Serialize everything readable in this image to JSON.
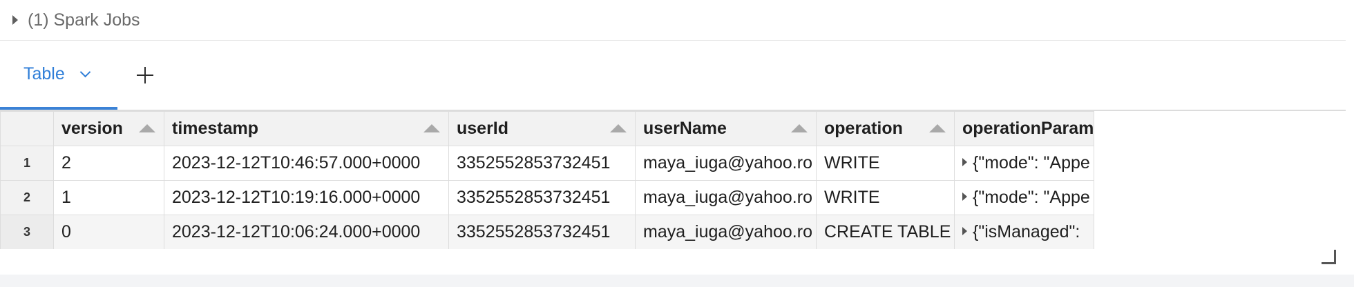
{
  "jobs": {
    "label": "(1) Spark Jobs"
  },
  "tabs": {
    "active_label": "Table"
  },
  "grid": {
    "columns": [
      "version",
      "timestamp",
      "userId",
      "userName",
      "operation",
      "operationParam"
    ],
    "rows": [
      {
        "num": "1",
        "version": "2",
        "timestamp": "2023-12-12T10:46:57.000+0000",
        "userId": "3352552853732451",
        "userName": "maya_iuga@yahoo.ro",
        "operation": "WRITE",
        "operationParameters": "{\"mode\": \"Appe"
      },
      {
        "num": "2",
        "version": "1",
        "timestamp": "2023-12-12T10:19:16.000+0000",
        "userId": "3352552853732451",
        "userName": "maya_iuga@yahoo.ro",
        "operation": "WRITE",
        "operationParameters": "{\"mode\": \"Appe"
      },
      {
        "num": "3",
        "version": "0",
        "timestamp": "2023-12-12T10:06:24.000+0000",
        "userId": "3352552853732451",
        "userName": "maya_iuga@yahoo.ro",
        "operation": "CREATE TABLE",
        "operationParameters": "{\"isManaged\": "
      }
    ]
  },
  "colors": {
    "accent": "#2f7ed8",
    "header_bg": "#f2f2f2",
    "grid_border": "#dddddd"
  },
  "icons": {
    "jobs_toggle": "caret-right-icon",
    "tab_menu": "chevron-down-icon",
    "add_tab": "plus-icon",
    "sort": "sort-ascending-icon",
    "resize": "resize-handle-icon"
  }
}
